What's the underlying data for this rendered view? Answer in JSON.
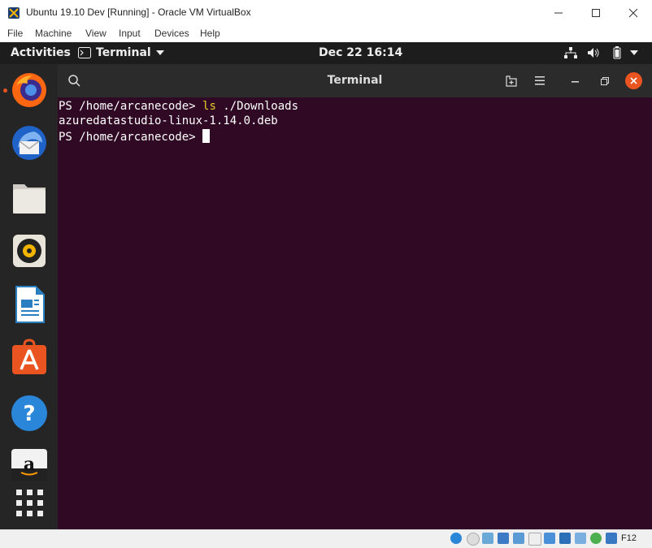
{
  "window": {
    "title": "Ubuntu 19.10 Dev [Running] - Oracle VM VirtualBox"
  },
  "menu": {
    "file": "File",
    "machine": "Machine",
    "view": "View",
    "input": "Input",
    "devices": "Devices",
    "help": "Help"
  },
  "topbar": {
    "activities": "Activities",
    "app_name": "Terminal",
    "clock": "Dec 22  16:14"
  },
  "terminal": {
    "title": "Terminal",
    "line1_prompt": "PS /home/arcanecode> ",
    "line1_cmd": "ls",
    "line1_args": " ./Downloads",
    "line2": "azuredatastudio-linux-1.14.0.deb",
    "line3_prompt": "PS /home/arcanecode> "
  },
  "dock_items": [
    "firefox-icon",
    "thunderbird-icon",
    "files-icon",
    "rhythmbox-icon",
    "libreoffice-writer-icon",
    "ubuntu-software-icon",
    "help-icon",
    "amazon-icon",
    "show-apps-icon"
  ],
  "statusbar": {
    "host_key": "F12"
  },
  "colors": {
    "terminal_bg": "#300a24",
    "command": "#e8c92c",
    "close_button": "#e95420"
  }
}
